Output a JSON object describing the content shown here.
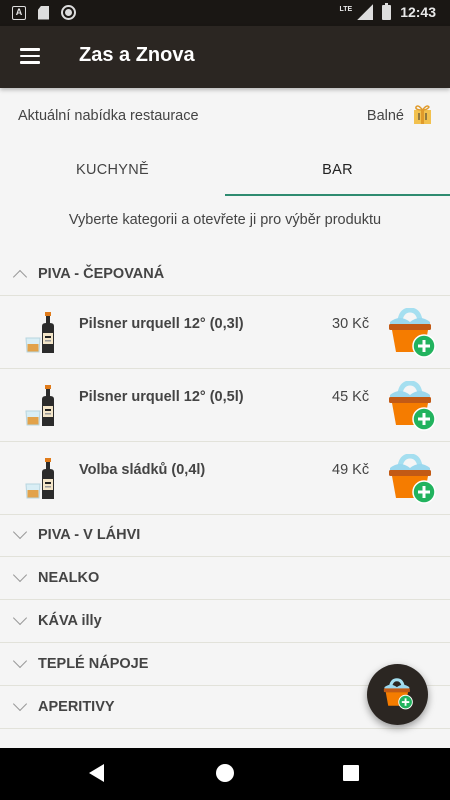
{
  "status_bar": {
    "time": "12:43",
    "network": "LTE"
  },
  "app_bar": {
    "title": "Zas a Znova",
    "menu_icon": "hamburger-menu-icon"
  },
  "info_bar": {
    "text": "Aktuální nabídka restaurace",
    "packaging_label": "Balné",
    "packaging_icon": "gift-bag-icon"
  },
  "tabs": [
    {
      "label": "KUCHYNĚ",
      "selected": false
    },
    {
      "label": "BAR",
      "selected": true
    }
  ],
  "hint": "Vyberte kategorii a otevřete ji pro výběr produktu",
  "categories": [
    {
      "label": "PIVA - ČEPOVANÁ",
      "expanded": true,
      "products": [
        {
          "name": "Pilsner urquell 12° (0,3l)",
          "price": "30 Kč"
        },
        {
          "name": "Pilsner urquell 12° (0,5l)",
          "price": "45 Kč"
        },
        {
          "name": "Volba sládků (0,4l)",
          "price": "49 Kč"
        }
      ]
    },
    {
      "label": "PIVA - V LÁHVI",
      "expanded": false
    },
    {
      "label": "NEALKO",
      "expanded": false
    },
    {
      "label": "KÁVA illy",
      "expanded": false
    },
    {
      "label": "TEPLÉ NÁPOJE",
      "expanded": false
    },
    {
      "label": "APERITIVY",
      "expanded": false
    }
  ],
  "colors": {
    "app_bar": "#2b2622",
    "tab_indicator": "#2e8b70",
    "cart_orange": "#f57c00",
    "cart_handle": "#a5dff0",
    "add_badge": "#22b35e"
  }
}
